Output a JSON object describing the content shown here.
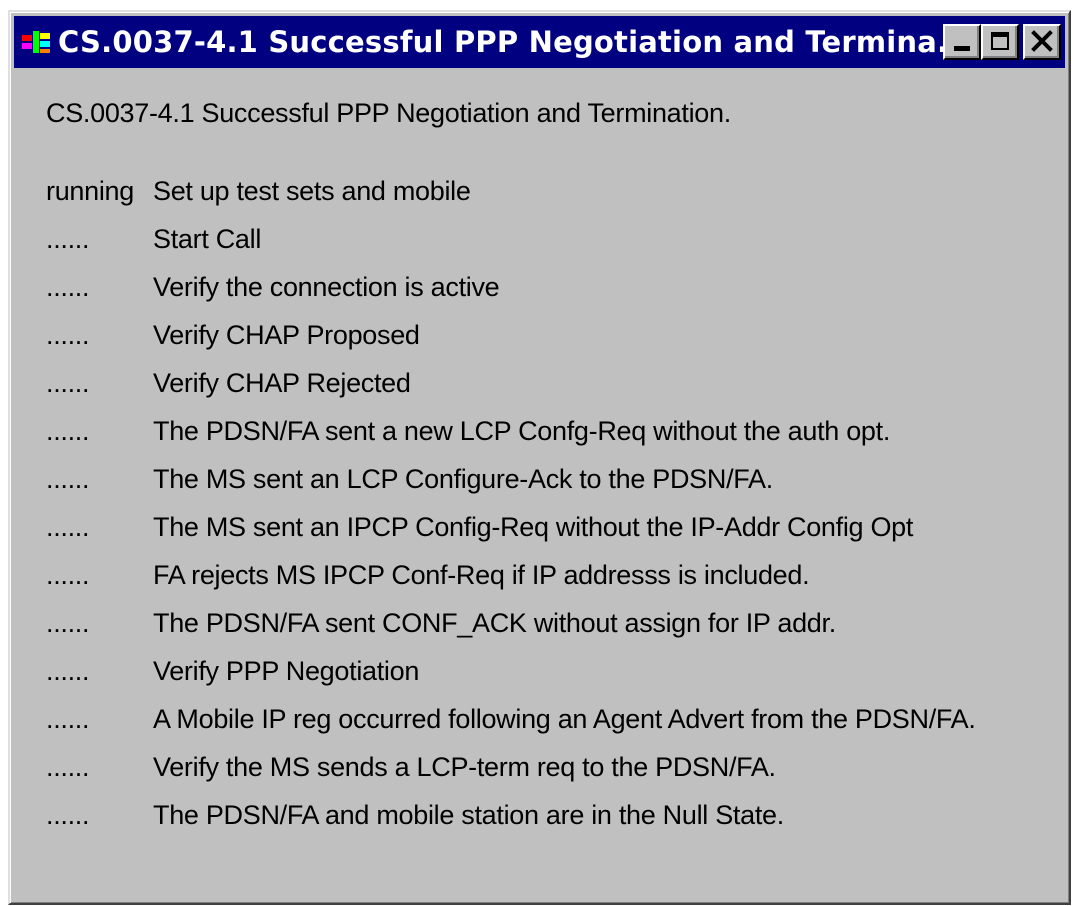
{
  "window": {
    "title": "CS.0037-4.1 Successful PPP Negotiation and Termina...",
    "app_icon": "test-app-icon",
    "controls": {
      "minimize": "minimize-icon",
      "maximize": "maximize-icon",
      "close": "close-icon"
    },
    "colors": {
      "titlebar": "#000080",
      "face": "#c0c0c0"
    }
  },
  "content": {
    "heading": "CS.0037-4.1 Successful PPP Negotiation and Termination.",
    "steps": [
      {
        "status": "running",
        "label": "Set up test sets and mobile"
      },
      {
        "status": "......",
        "label": "Start Call"
      },
      {
        "status": "......",
        "label": "Verify the connection is active"
      },
      {
        "status": "......",
        "label": "Verify CHAP Proposed"
      },
      {
        "status": "......",
        "label": "Verify CHAP Rejected"
      },
      {
        "status": "......",
        "label": "The PDSN/FA sent a new LCP Confg-Req without the auth opt."
      },
      {
        "status": "......",
        "label": "The MS sent an LCP Configure-Ack to the PDSN/FA."
      },
      {
        "status": "......",
        "label": "The MS sent an IPCP Config-Req without the IP-Addr Config Opt"
      },
      {
        "status": "......",
        "label": "FA rejects MS IPCP Conf-Req if IP addresss is included."
      },
      {
        "status": "......",
        "label": "The PDSN/FA sent CONF_ACK without assign for IP addr."
      },
      {
        "status": "......",
        "label": "Verify PPP Negotiation"
      },
      {
        "status": "......",
        "label": "A Mobile IP reg occurred following an Agent Advert from the PDSN/FA."
      },
      {
        "status": "......",
        "label": "Verify the MS sends a LCP-term req to the PDSN/FA."
      },
      {
        "status": "......",
        "label": "The PDSN/FA and mobile station are in the Null State."
      }
    ]
  }
}
